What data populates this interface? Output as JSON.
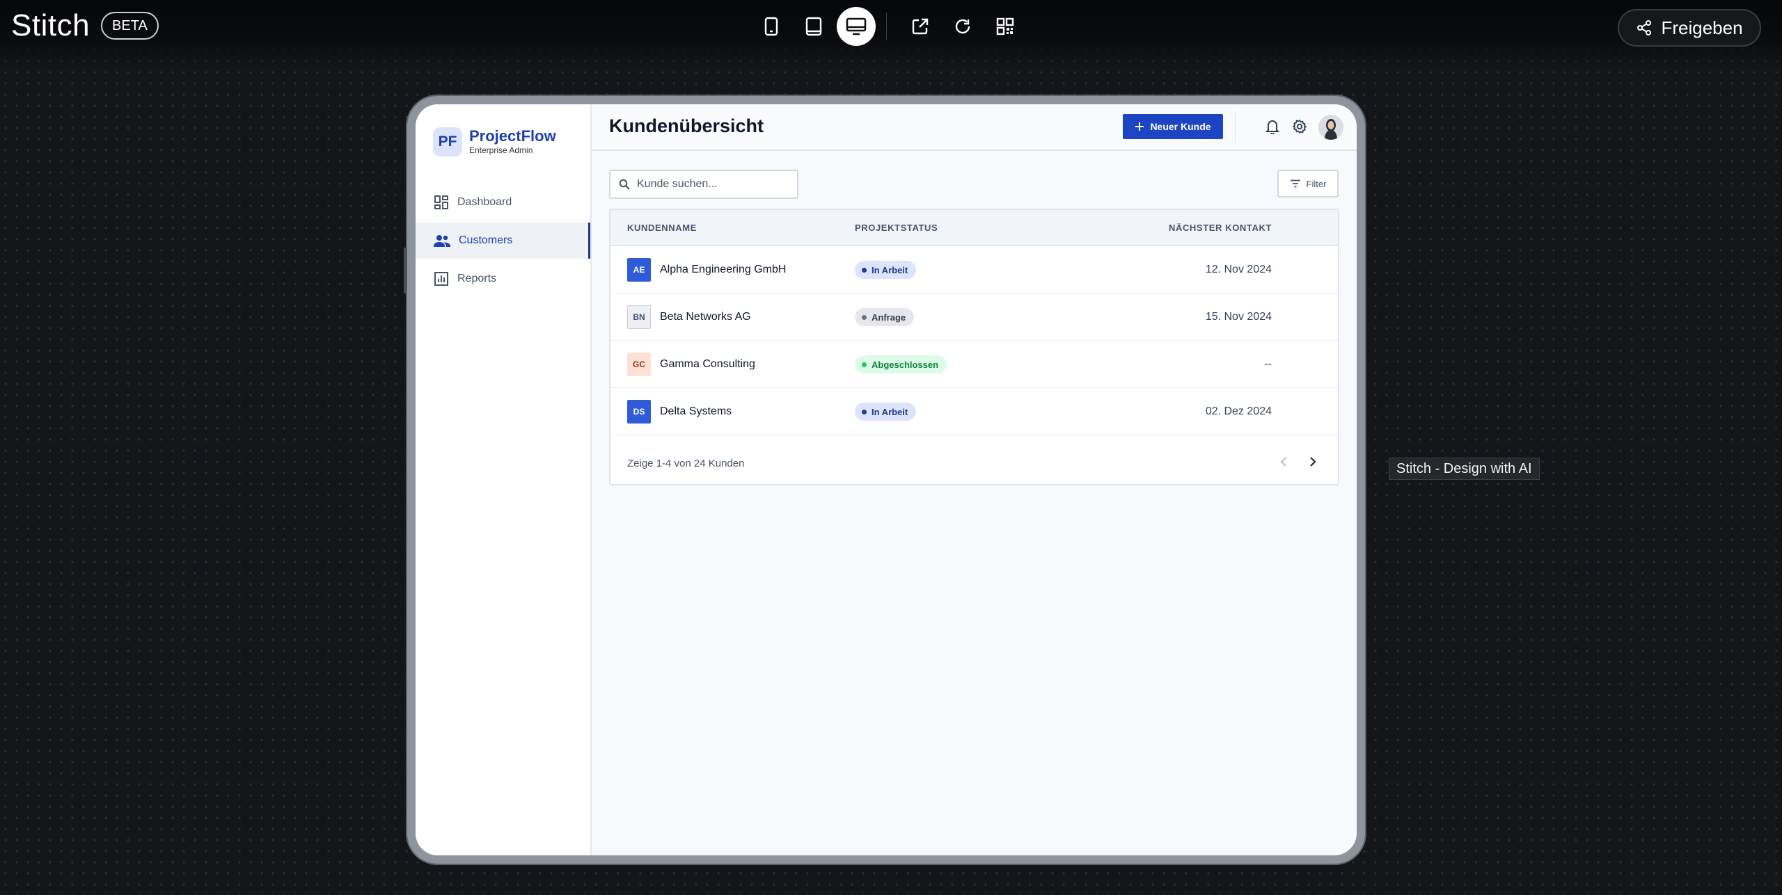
{
  "app": {
    "brand": "Stitch",
    "badge": "BETA"
  },
  "toolbar": {
    "devices": [
      {
        "name": "mobile",
        "icon": "phone-icon"
      },
      {
        "name": "tablet",
        "icon": "tablet-icon"
      },
      {
        "name": "desktop",
        "icon": "monitor-icon",
        "active": true
      }
    ],
    "actions": [
      "open-external-icon",
      "refresh-icon",
      "qr-code-icon"
    ],
    "share_label": "Freigeben"
  },
  "preview": {
    "sidebar": {
      "logo_initials": "PF",
      "logo_title": "ProjectFlow",
      "logo_subtitle": "Enterprise Admin",
      "items": [
        {
          "label": "Dashboard",
          "icon": "dashboard-icon"
        },
        {
          "label": "Customers",
          "icon": "users-icon",
          "active": true
        },
        {
          "label": "Reports",
          "icon": "bar-chart-icon"
        }
      ]
    },
    "header": {
      "title": "Kundenübersicht",
      "new_button": "Neuer Kunde"
    },
    "search": {
      "placeholder": "Kunde suchen..."
    },
    "filter_label": "Filter",
    "table": {
      "columns": [
        "KUNDENNAME",
        "PROJEKTSTATUS",
        "NÄCHSTER KONTAKT"
      ],
      "rows": [
        {
          "initials": "AE",
          "name": "Alpha Engineering GmbH",
          "status": "In Arbeit",
          "date": "12. Nov 2024"
        },
        {
          "initials": "BN",
          "name": "Beta Networks AG",
          "status": "Anfrage",
          "date": "15. Nov 2024"
        },
        {
          "initials": "GC",
          "name": "Gamma Consulting",
          "status": "Abgeschlossen",
          "date": "--"
        },
        {
          "initials": "DS",
          "name": "Delta Systems",
          "status": "In Arbeit",
          "date": "02. Dez 2024"
        }
      ],
      "footer": "Zeige 1-4 von 24 Kunden"
    }
  },
  "tooltip": "Stitch - Design with AI",
  "colors": {
    "accent": "#1d45c3",
    "status_in_arbeit_bg": "#dbe4fb",
    "status_anfrage_bg": "#e5e7eb",
    "status_abgeschlossen_bg": "#dcfce7"
  }
}
